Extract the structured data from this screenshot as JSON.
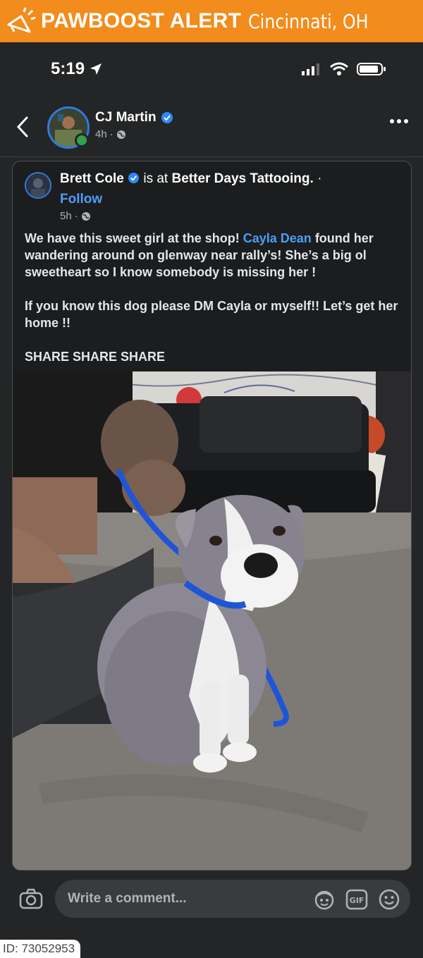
{
  "banner": {
    "brand": "PAWBOOST ALERT",
    "city": "Cincinnati, OH",
    "icon": "megaphone-icon",
    "color": "#f28c1c"
  },
  "status_bar": {
    "time": "5:19"
  },
  "header": {
    "name": "CJ Martin",
    "time": "4h",
    "verified": true
  },
  "post": {
    "author": "Brett Cole",
    "location_prefix": "is at",
    "location": "Better Days Tattooing.",
    "follow_label": "Follow",
    "time": "5h",
    "text_part1": "We have this sweet girl at the shop! ",
    "mention": "Cayla Dean",
    "text_part2": " found her wandering around on glenway near rally’s! She’s a big ol sweetheart so I know somebody is missing her !",
    "paragraph2": "If you know this dog please DM Cayla or myself!! Let’s get her home !!",
    "paragraph3": "SHARE SHARE SHARE"
  },
  "comment": {
    "placeholder": "Write a comment..."
  },
  "id_tag": "ID: 73052953"
}
